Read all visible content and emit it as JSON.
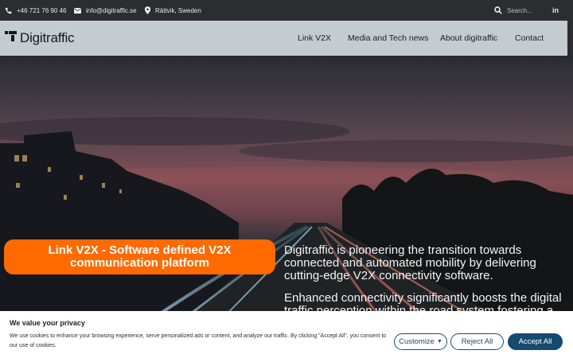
{
  "topbar": {
    "phone": "+46 721 76 90 46",
    "email": "info@digitraffic.se",
    "location": "Rättvik, Sweden",
    "search_placeholder": "Search...",
    "linkedin": "in"
  },
  "header": {
    "logo_text": "Digitraffic",
    "nav": [
      "Link V2X",
      "Media and Tech news",
      "About digitraffic",
      "Contact"
    ]
  },
  "hero": {
    "pill_text": "Link V2X - Software defined V2X communication platform",
    "paragraph_1": "Digitraffic is pioneering the transition towards connected and automated mobility by delivering cutting-edge V2X connectivity software.",
    "paragraph_2": "Enhanced connectivity significantly boosts the digital traffic perception within the road system fostering a"
  },
  "cookie": {
    "title": "We value your privacy",
    "description": "We use cookies to enhance your browsing experience, serve personalized ads or content, and analyze our traffic. By clicking \"Accept All\", you consent to our use of cookies.",
    "customize_label": "Customize",
    "reject_label": "Reject All",
    "accept_label": "Accept All"
  },
  "colors": {
    "accent_orange": "#ff6a00",
    "header_bg": "#c5ccd0",
    "topbar_bg": "#2b2d31",
    "button_blue": "#164a6e"
  },
  "icons": [
    "phone-icon",
    "mail-icon",
    "location-icon",
    "search-icon",
    "linkedin-icon",
    "logo-icon",
    "chevron-down-icon"
  ]
}
